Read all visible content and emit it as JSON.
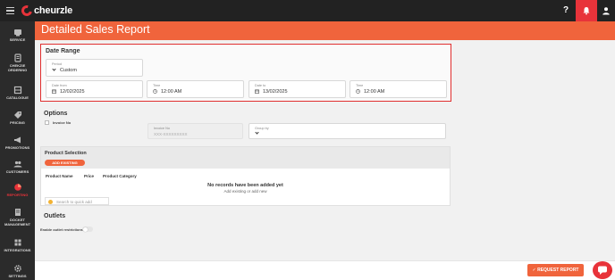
{
  "app": {
    "logo_text": "cheurzle"
  },
  "topbar": {
    "help_label": "?"
  },
  "sidebar": {
    "items": [
      {
        "label": "SERVICE"
      },
      {
        "label": "CHEKZIE ORDERING"
      },
      {
        "label": "CATALOGUE"
      },
      {
        "label": "PRICING"
      },
      {
        "label": "PROMOTIONS"
      },
      {
        "label": "CUSTOMERS"
      },
      {
        "label": "REPORTING"
      },
      {
        "label": "DOCKET MANAGEMENT"
      },
      {
        "label": "INTEGRATIONS"
      },
      {
        "label": "SETTINGS"
      }
    ]
  },
  "page": {
    "title": "Detailed Sales Report"
  },
  "date_range": {
    "title": "Date Range",
    "period_label": "Period",
    "period_value": "Custom",
    "date_from_label": "Date from",
    "date_from_value": "12/02/2025",
    "time_from_label": "Time",
    "time_from_value": "12:00 AM",
    "date_to_label": "Date to",
    "date_to_value": "13/02/2025",
    "time_to_label": "Time",
    "time_to_value": "12:00 AM"
  },
  "options": {
    "title": "Options",
    "invoice_checkbox_label": "Invoice No",
    "invoice_field_label": "Invoice No",
    "invoice_placeholder": "XXX-XXXXXXXXX",
    "group_by_label": "Group by",
    "group_by_value": ""
  },
  "product_selection": {
    "title": "Product Selection",
    "add_existing_label": "ADD EXISTING",
    "columns": [
      "Product Name",
      "Price",
      "Product Category"
    ],
    "empty_title": "No records have been added yet",
    "empty_subtitle": "Add existing or add new",
    "quick_add_placeholder": "Search to quick add"
  },
  "outlets": {
    "title": "Outlets",
    "restrictions_label": "Enable outlet restrictions"
  },
  "footer": {
    "request_label": "REQUEST REPORT"
  },
  "colors": {
    "accent": "#f0643c",
    "brand_red": "#e8333a",
    "sidebar_bg": "#2b2b2b",
    "topbar_bg": "#222222",
    "highlight_border": "#e02f2f"
  }
}
